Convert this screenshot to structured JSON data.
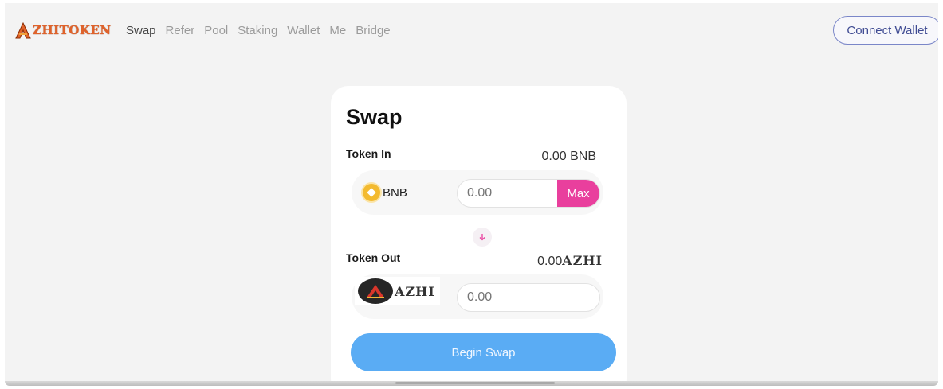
{
  "brand": {
    "logo_text": "AZHITOKEN",
    "logo_color": "#e0622a"
  },
  "nav": {
    "items": [
      "Swap",
      "Refer",
      "Pool",
      "Staking",
      "Wallet",
      "Me",
      "Bridge"
    ],
    "active": "Swap"
  },
  "header": {
    "connect_label": "Connect Wallet"
  },
  "swap": {
    "title": "Swap",
    "token_in": {
      "label": "Token In",
      "balance": "0.00 BNB",
      "symbol": "BNB",
      "icon": "bnb-coin-icon",
      "amount_placeholder": "0.00",
      "max_label": "Max"
    },
    "direction_icon": "arrow-down-icon",
    "token_out": {
      "label": "Token Out",
      "balance": "0.00",
      "balance_symbol": "AZHI",
      "symbol": "AZHI",
      "icon": "azhi-logo-icon",
      "amount_placeholder": "0.00"
    },
    "begin_label": "Begin Swap"
  },
  "colors": {
    "accent_pink": "#e93f9d",
    "primary_blue": "#5aacf4",
    "connect_border": "#7a86c8"
  }
}
